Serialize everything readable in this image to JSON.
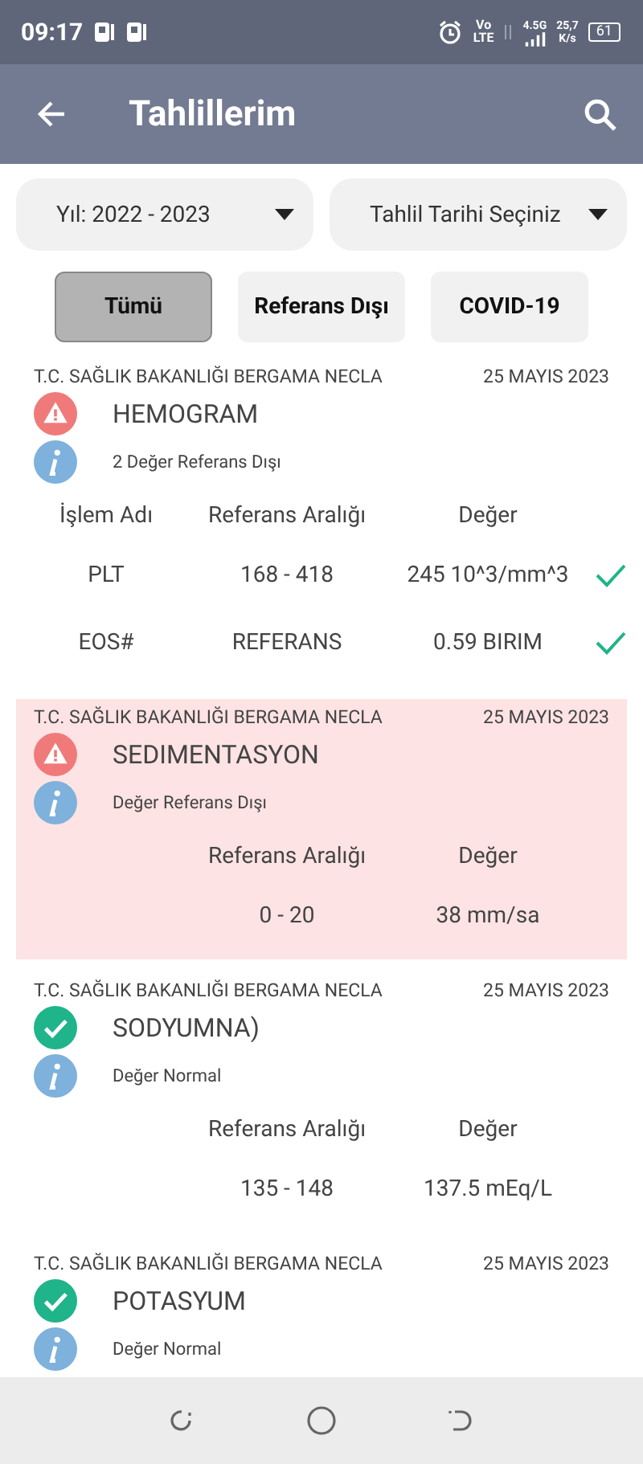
{
  "status_bar": {
    "time": "09:17",
    "network_top": "Vo",
    "network_bottom": "LTE",
    "signal_label": "4.5G",
    "speed": "25,7",
    "speed_unit": "K/s",
    "battery": "61"
  },
  "app_bar": {
    "title": "Tahlillerim"
  },
  "filters": [
    {
      "label": "Yıl: 2022 - 2023"
    },
    {
      "label": "Tahlil Tarihi Seçiniz"
    }
  ],
  "tabs": [
    {
      "label": "Tümü",
      "selected": true
    },
    {
      "label": "Referans Dışı",
      "selected": false
    },
    {
      "label": "COVID-19",
      "selected": false
    }
  ],
  "results": [
    {
      "lab": "T.C. SAĞLIK BAKANLIĞI BERGAMA NECLA",
      "date": "25 MAYIS 2023",
      "kind": "alert",
      "highlighted": false,
      "name": "HEMOGRAM",
      "note": "2 Değer Referans Dışı",
      "columns": [
        "İşlem Adı",
        "Referans Aralığı",
        "Değer"
      ],
      "rows": [
        {
          "cells": [
            "PLT",
            "168 - 418",
            "245 10^3/mm^3"
          ],
          "checked": true
        },
        {
          "cells": [
            "EOS#",
            "REFERANS",
            "0.59 BIRIM"
          ],
          "checked": true
        }
      ]
    },
    {
      "lab": "T.C. SAĞLIK BAKANLIĞI BERGAMA NECLA",
      "date": "25 MAYIS 2023",
      "kind": "alert",
      "highlighted": true,
      "name": "SEDIMENTASYON",
      "note": "Değer Referans Dışı",
      "columns": [
        "Referans Aralığı",
        "Değer"
      ],
      "rows": [
        {
          "cells": [
            "0 - 20",
            "38 mm/sa"
          ],
          "checked": false
        }
      ]
    },
    {
      "lab": "T.C. SAĞLIK BAKANLIĞI BERGAMA NECLA",
      "date": "25 MAYIS 2023",
      "kind": "normal",
      "highlighted": false,
      "name": "SODYUMNA)",
      "note": "Değer Normal",
      "columns": [
        "Referans Aralığı",
        "Değer"
      ],
      "rows": [
        {
          "cells": [
            "135 - 148",
            "137.5 mEq/L"
          ],
          "checked": false
        }
      ]
    },
    {
      "lab": "T.C. SAĞLIK BAKANLIĞI BERGAMA NECLA",
      "date": "25 MAYIS 2023",
      "kind": "normal",
      "highlighted": false,
      "name": "POTASYUM",
      "note": "Değer Normal"
    }
  ]
}
